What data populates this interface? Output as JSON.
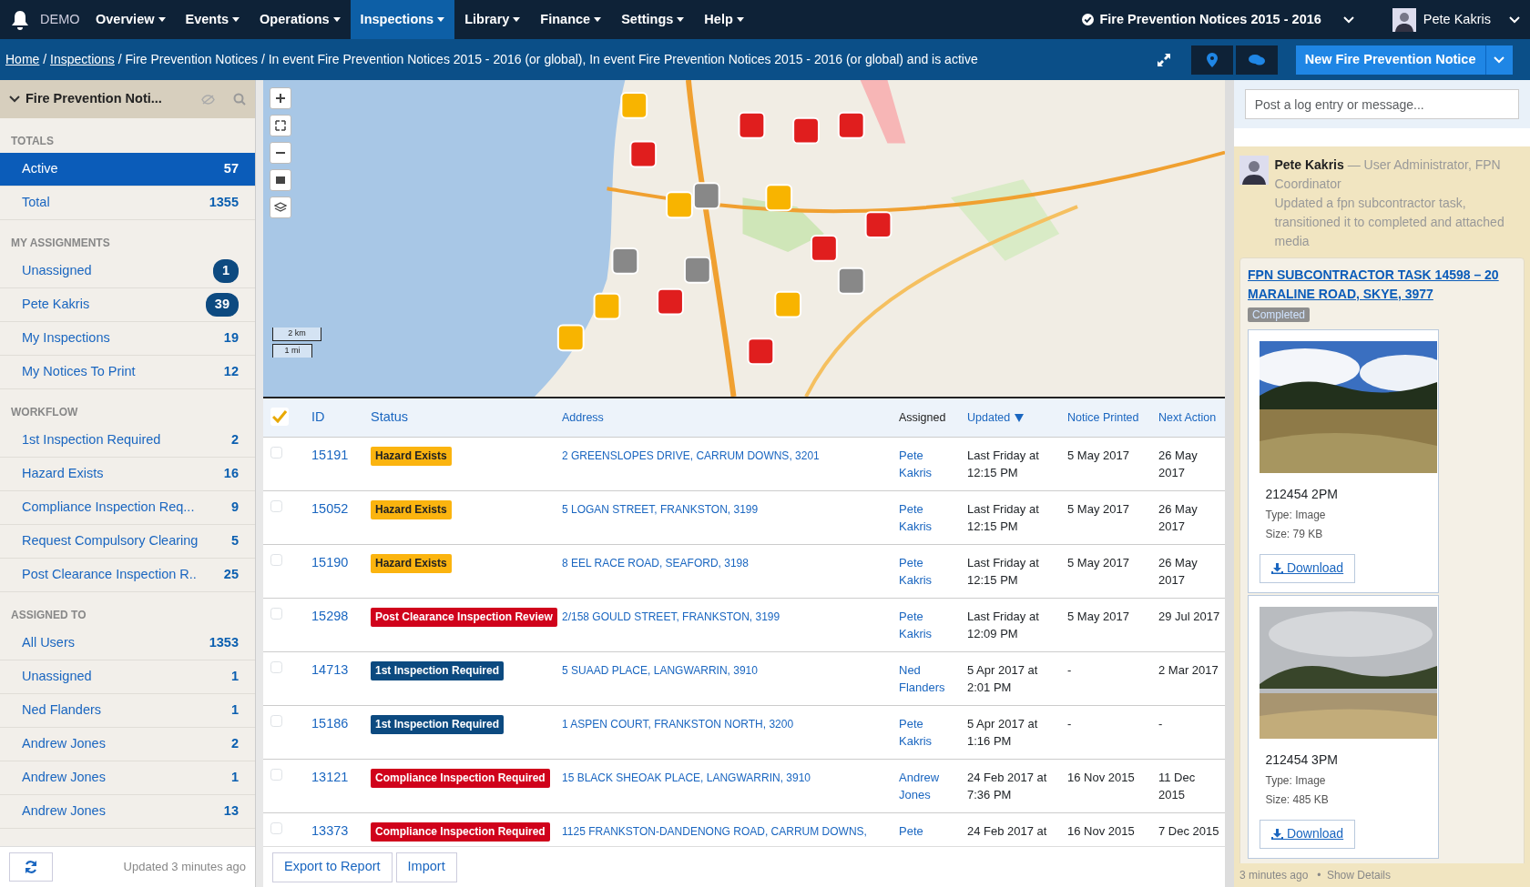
{
  "nav": {
    "brand": "DEMO",
    "menus": [
      {
        "label": "Overview",
        "selected": false
      },
      {
        "label": "Events",
        "selected": false
      },
      {
        "label": "Operations",
        "selected": false
      },
      {
        "label": "Inspections",
        "selected": true
      },
      {
        "label": "Library",
        "selected": false
      },
      {
        "label": "Finance",
        "selected": false
      },
      {
        "label": "Settings",
        "selected": false
      },
      {
        "label": "Help",
        "selected": false
      }
    ],
    "program": "Fire Prevention Notices 2015 - 2016",
    "user": "Pete Kakris"
  },
  "breadcrumb": [
    {
      "kind": "link",
      "text": "Home"
    },
    {
      "kind": "text",
      "text": "/"
    },
    {
      "kind": "link",
      "text": "Inspections"
    },
    {
      "kind": "text",
      "text": "/ Fire Prevention Notices / In event Fire Prevention Notices 2015 - 2016 (or global), In event Fire Prevention Notices 2015 - 2016 (or global) and is active"
    }
  ],
  "new_button": "New Fire Prevention Notice",
  "sidebar": {
    "title": "Fire Prevention Noti...",
    "sections": [
      {
        "heading": "TOTALS",
        "items": [
          {
            "label": "Active",
            "count": "57",
            "selected": true,
            "badge": false
          },
          {
            "label": "Total",
            "count": "1355",
            "selected": false,
            "badge": false
          }
        ]
      },
      {
        "heading": "MY ASSIGNMENTS",
        "items": [
          {
            "label": "Unassigned",
            "count": "1",
            "selected": false,
            "badge": true
          },
          {
            "label": "Pete Kakris",
            "count": "39",
            "selected": false,
            "badge": true
          },
          {
            "label": "My Inspections",
            "count": "19",
            "selected": false,
            "badge": false
          },
          {
            "label": "My Notices To Print",
            "count": "12",
            "selected": false,
            "badge": false
          }
        ]
      },
      {
        "heading": "WORKFLOW",
        "items": [
          {
            "label": "1st Inspection Required",
            "count": "2",
            "selected": false,
            "badge": false
          },
          {
            "label": "Hazard Exists",
            "count": "16",
            "selected": false,
            "badge": false
          },
          {
            "label": "Compliance Inspection Req...",
            "count": "9",
            "selected": false,
            "badge": false
          },
          {
            "label": "Request Compulsory Clearing",
            "count": "5",
            "selected": false,
            "badge": false
          },
          {
            "label": "Post Clearance Inspection R..",
            "count": "25",
            "selected": false,
            "badge": false
          }
        ]
      },
      {
        "heading": "ASSIGNED TO",
        "items": [
          {
            "label": "All Users",
            "count": "1353",
            "selected": false,
            "badge": false
          },
          {
            "label": "Unassigned",
            "count": "1",
            "selected": false,
            "badge": false
          },
          {
            "label": "Ned Flanders",
            "count": "1",
            "selected": false,
            "badge": false
          },
          {
            "label": "Andrew Jones",
            "count": "2",
            "selected": false,
            "badge": false
          },
          {
            "label": "Andrew Jones",
            "count": "1",
            "selected": false,
            "badge": false
          },
          {
            "label": "Andrew Jones",
            "count": "13",
            "selected": false,
            "badge": false
          }
        ]
      }
    ],
    "updated": "Updated 3 minutes ago"
  },
  "map": {
    "scale_metric": "2 km",
    "scale_imperial": "1 mi"
  },
  "table": {
    "all_checked": true,
    "columns": [
      {
        "label": "ID",
        "link": true,
        "sorted": false
      },
      {
        "label": "Status",
        "link": true,
        "sorted": false
      },
      {
        "label": "Address",
        "link": true,
        "sorted": false
      },
      {
        "label": "Assigned",
        "link": false,
        "sorted": false
      },
      {
        "label": "Updated",
        "link": true,
        "sorted": true
      },
      {
        "label": "Notice Printed",
        "link": true,
        "sorted": false
      },
      {
        "label": "Next Action",
        "link": true,
        "sorted": false
      }
    ],
    "rows": [
      {
        "checked": false,
        "id": "15191",
        "status": {
          "label": "Hazard Exists",
          "color": "#fbb40f"
        },
        "address": "2 GREENSLOPES DRIVE, CARRUM DOWNS, 3201",
        "assigned": "Pete Kakris",
        "updated": "Last Friday at 12:15 PM",
        "printed": "5 May 2017",
        "next": "26 May 2017"
      },
      {
        "checked": false,
        "id": "15052",
        "status": {
          "label": "Hazard Exists",
          "color": "#fbb40f"
        },
        "address": "5 LOGAN STREET, FRANKSTON, 3199",
        "assigned": "Pete Kakris",
        "updated": "Last Friday at 12:15 PM",
        "printed": "5 May 2017",
        "next": "26 May 2017"
      },
      {
        "checked": false,
        "id": "15190",
        "status": {
          "label": "Hazard Exists",
          "color": "#fbb40f"
        },
        "address": "8 EEL RACE ROAD, SEAFORD, 3198",
        "assigned": "Pete Kakris",
        "updated": "Last Friday at 12:15 PM",
        "printed": "5 May 2017",
        "next": "26 May 2017"
      },
      {
        "checked": false,
        "id": "15298",
        "status": {
          "label": "Post Clearance Inspection Review",
          "color": "#d0021b"
        },
        "address": "2/158 GOULD STREET, FRANKSTON, 3199",
        "assigned": "Pete Kakris",
        "updated": "Last Friday at 12:09 PM",
        "printed": "5 May 2017",
        "next": "29 Jul 2017"
      },
      {
        "checked": false,
        "id": "14713",
        "status": {
          "label": "1st Inspection Required",
          "color": "#0c4a80"
        },
        "address": "5 SUAAD PLACE, LANGWARRIN, 3910",
        "assigned": "Ned Flanders",
        "updated": "5 Apr 2017 at 2:01 PM",
        "printed": "-",
        "next": "2 Mar 2017"
      },
      {
        "checked": false,
        "id": "15186",
        "status": {
          "label": "1st Inspection Required",
          "color": "#0c4a80"
        },
        "address": "1 ASPEN COURT, FRANKSTON NORTH, 3200",
        "assigned": "Pete Kakris",
        "updated": "5 Apr 2017 at 1:16 PM",
        "printed": "-",
        "next": "-"
      },
      {
        "checked": false,
        "id": "13121",
        "status": {
          "label": "Compliance Inspection Required",
          "color": "#d0021b"
        },
        "address": "15 BLACK SHEOAK PLACE, LANGWARRIN, 3910",
        "assigned": "Andrew Jones",
        "updated": "24 Feb 2017 at 7:36 PM",
        "printed": "16 Nov 2015",
        "next": "11 Dec 2015"
      },
      {
        "checked": false,
        "id": "13373",
        "status": {
          "label": "Compliance Inspection Required",
          "color": "#d0021b"
        },
        "address": "1125 FRANKSTON-DANDENONG ROAD, CARRUM DOWNS,",
        "assigned": "Pete",
        "updated": "24 Feb 2017 at",
        "printed": "16 Nov 2015",
        "next": "7 Dec 2015"
      }
    ]
  },
  "footer_buttons": [
    "Export to Report",
    "Import"
  ],
  "activity": {
    "placeholder": "Post a log entry or message...",
    "author": "Pete Kakris",
    "role": "— User Administrator, FPN Coordinator",
    "text": "Updated a fpn subcontractor task, transitioned it to completed and attached media",
    "task": "FPN SUBCONTRACTOR TASK 14598 – 20 MARALINE ROAD, SKYE, 3977",
    "task_status": "Completed",
    "attachments": [
      {
        "name": "212454 2PM",
        "type": "Type: Image",
        "size": "Size: 79 KB",
        "download": "Download",
        "kind": "grass"
      },
      {
        "name": "212454 3PM",
        "type": "Type: Image",
        "size": "Size: 485 KB",
        "download": "Download",
        "kind": "cleared"
      }
    ],
    "time": "3 minutes ago",
    "separator": "•",
    "details": "Show Details"
  }
}
